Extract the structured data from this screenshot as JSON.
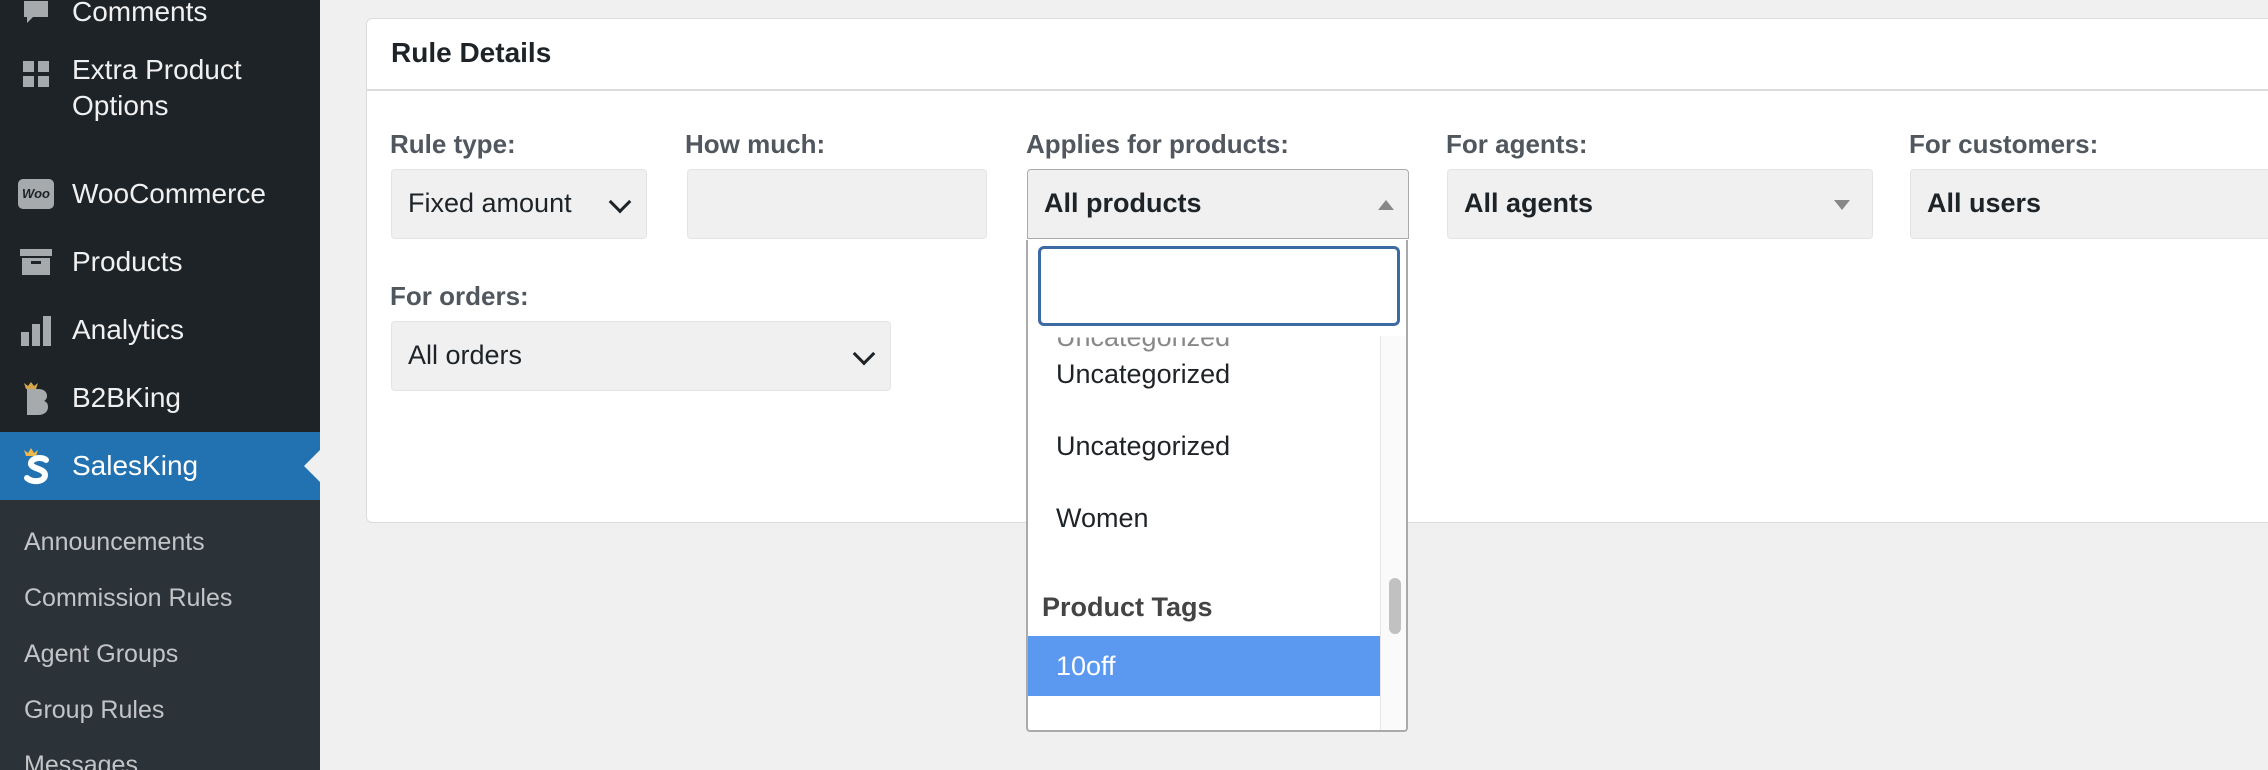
{
  "sidebar": {
    "items": [
      {
        "label": "Comments",
        "icon": "comment-icon"
      },
      {
        "label": "Extra Product\nOptions",
        "icon": "grid-icon"
      },
      {
        "label": "WooCommerce",
        "icon": "woo-icon"
      },
      {
        "label": "Products",
        "icon": "archive-icon"
      },
      {
        "label": "Analytics",
        "icon": "bar-chart-icon"
      },
      {
        "label": "B2BKing",
        "icon": "b2bking-icon"
      },
      {
        "label": "SalesKing",
        "icon": "salesking-icon"
      }
    ],
    "woo_icon_text": "Woo",
    "submenu": [
      "Announcements",
      "Commission Rules",
      "Agent Groups",
      "Group Rules",
      "Messages"
    ]
  },
  "card": {
    "title": "Rule Details",
    "fields": {
      "rule_type": {
        "label": "Rule type:",
        "value": "Fixed amount"
      },
      "how_much": {
        "label": "How much:",
        "value": ""
      },
      "applies": {
        "label": "Applies for products:",
        "value": "All products"
      },
      "agents": {
        "label": "For agents:",
        "value": "All agents"
      },
      "customers": {
        "label": "For customers:",
        "value": "All users"
      },
      "orders": {
        "label": "For orders:",
        "value": "All orders"
      }
    }
  },
  "dropdown": {
    "search_value": "",
    "options": [
      "Uncategorized",
      "Uncategorized",
      "Women"
    ],
    "group": "Product Tags",
    "highlighted": "10off"
  },
  "colors": {
    "sidebar_bg": "#1d2327",
    "active_bg": "#2271b1",
    "highlight": "#5b98f0"
  }
}
